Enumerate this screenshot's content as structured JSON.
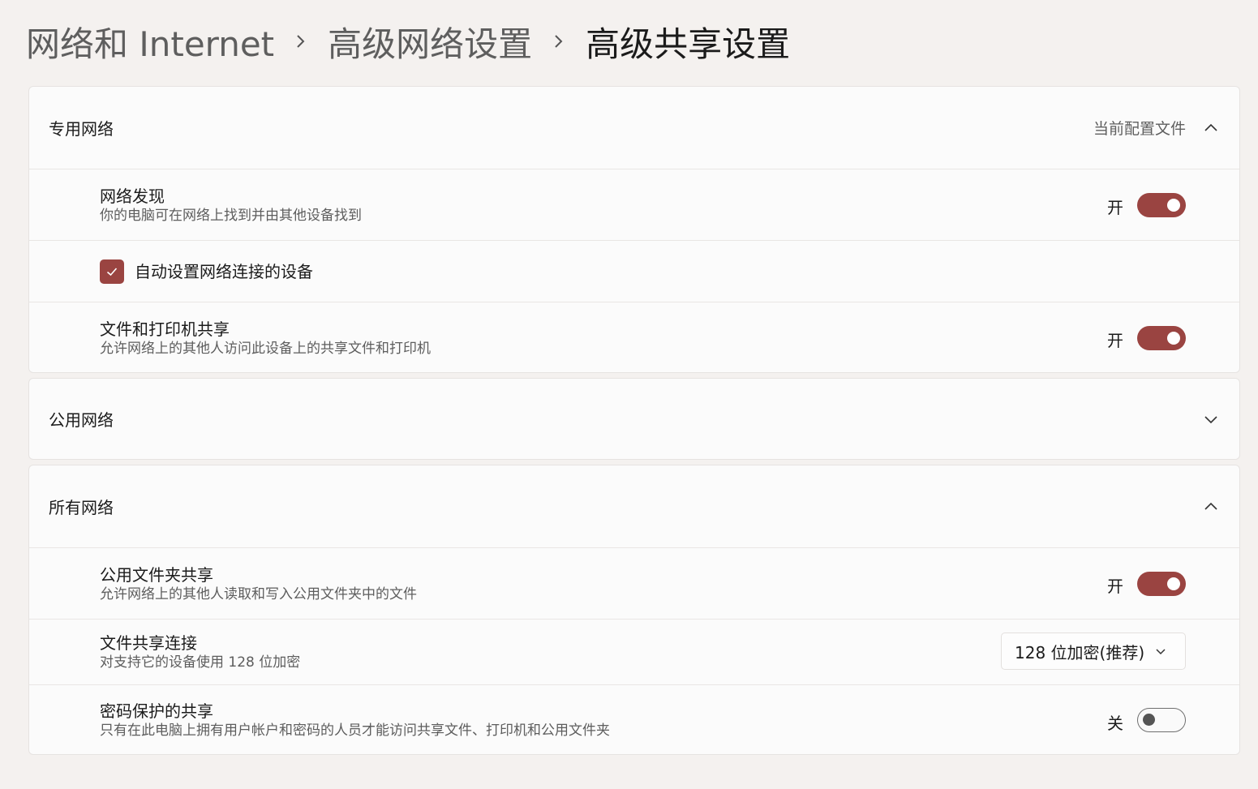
{
  "breadcrumb": {
    "items": [
      "网络和 Internet",
      "高级网络设置"
    ],
    "current": "高级共享设置"
  },
  "private_network": {
    "title": "专用网络",
    "note": "当前配置文件",
    "expanded": true,
    "network_discovery": {
      "title": "网络发现",
      "description": "你的电脑可在网络上找到并由其他设备找到",
      "state_label": "开",
      "on": true
    },
    "auto_setup": {
      "label": "自动设置网络连接的设备",
      "checked": true
    },
    "file_printer_sharing": {
      "title": "文件和打印机共享",
      "description": "允许网络上的其他人访问此设备上的共享文件和打印机",
      "state_label": "开",
      "on": true
    }
  },
  "public_network": {
    "title": "公用网络",
    "expanded": false
  },
  "all_networks": {
    "title": "所有网络",
    "expanded": true,
    "public_folder_sharing": {
      "title": "公用文件夹共享",
      "description": "允许网络上的其他人读取和写入公用文件夹中的文件",
      "state_label": "开",
      "on": true
    },
    "file_sharing_connections": {
      "title": "文件共享连接",
      "description": "对支持它的设备使用 128 位加密",
      "selected": "128 位加密(推荐)"
    },
    "password_protected_sharing": {
      "title": "密码保护的共享",
      "description": "只有在此电脑上拥有用户帐户和密码的人员才能访问共享文件、打印机和公用文件夹",
      "state_label": "关",
      "on": false
    }
  },
  "colors": {
    "accent": "#9a4441",
    "background": "#f4f1ef",
    "card": "#fbfbfb"
  }
}
